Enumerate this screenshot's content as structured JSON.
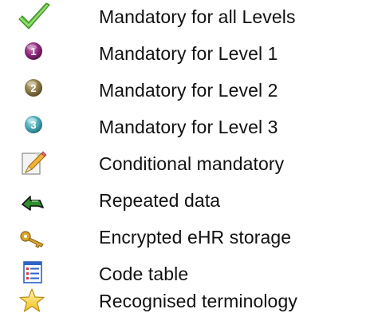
{
  "legend": {
    "items": [
      {
        "icon": "green-checkmark-icon",
        "label": "Mandatory for all Levels"
      },
      {
        "icon": "level-1-badge-icon",
        "label": "Mandatory for Level 1",
        "number": "1",
        "color": "#7a1f6b"
      },
      {
        "icon": "level-2-badge-icon",
        "label": "Mandatory for Level 2",
        "number": "2",
        "color": "#7a6a3a"
      },
      {
        "icon": "level-3-badge-icon",
        "label": "Mandatory for Level 3",
        "number": "3",
        "color": "#3a9aa6"
      },
      {
        "icon": "edit-pencil-icon",
        "label": "Conditional mandatory"
      },
      {
        "icon": "repeat-arrow-icon",
        "label": "Repeated data"
      },
      {
        "icon": "key-icon",
        "label": "Encrypted eHR storage"
      },
      {
        "icon": "list-table-icon",
        "label": "Code table"
      },
      {
        "icon": "star-icon",
        "label": "Recognised terminology"
      }
    ]
  }
}
